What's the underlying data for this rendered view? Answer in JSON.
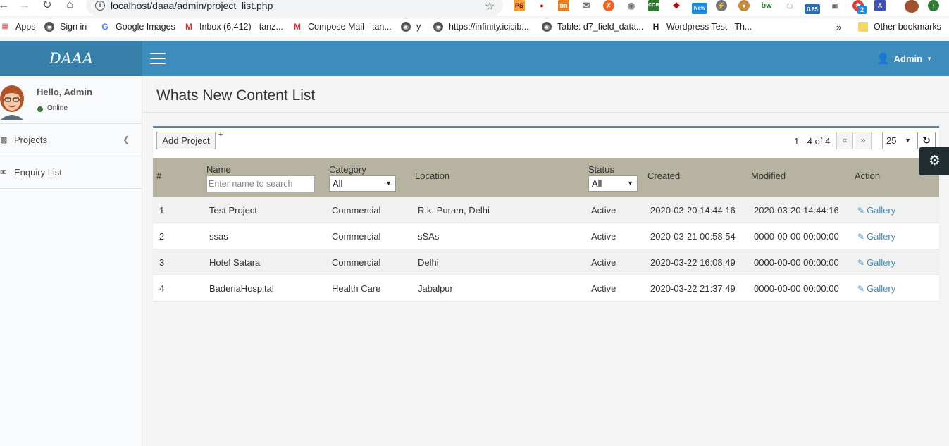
{
  "browser": {
    "url_host": "localhost",
    "url_path": "/daaa/admin/project_list.php",
    "bookmarks": [
      {
        "label": "Apps",
        "icon": "apps-grid-icon"
      },
      {
        "label": "Sign in",
        "icon": "globe-icon"
      },
      {
        "label": "Google Images",
        "icon": "google-icon"
      },
      {
        "label": "Inbox (6,412) - tanz...",
        "icon": "gmail-icon"
      },
      {
        "label": "Compose Mail - tan...",
        "icon": "gmail-icon"
      },
      {
        "label": "y",
        "icon": "globe-icon"
      },
      {
        "label": "https://infinity.icicib...",
        "icon": "globe-icon"
      },
      {
        "label": "Table: d7_field_data...",
        "icon": "globe-icon"
      },
      {
        "label": "Wordpress Test | Th...",
        "icon": "h-icon"
      }
    ],
    "more_bookmarks": "»",
    "other_bookmarks": "Other bookmarks",
    "extension_badges": {
      "new": "New",
      "speed": "0.85",
      "count": "2"
    }
  },
  "header": {
    "logo": "DAAA",
    "user_label": "Admin"
  },
  "sidebar": {
    "greeting": "Hello, Admin",
    "status": "Online",
    "items": [
      {
        "label": "Projects",
        "icon": "bar-chart-icon"
      },
      {
        "label": "Enquiry List",
        "icon": "envelope-icon"
      }
    ]
  },
  "page": {
    "title": "Whats New Content List"
  },
  "toolbar": {
    "add_label": "Add Project",
    "plus": "+",
    "pager_info": "1 - 4 of 4",
    "prev": "«",
    "next": "»",
    "page_size": "25"
  },
  "table": {
    "columns": {
      "num": "#",
      "name": "Name",
      "category": "Category",
      "location": "Location",
      "status": "Status",
      "created": "Created",
      "modified": "Modified",
      "action": "Action"
    },
    "search_placeholder": "Enter name to search",
    "category_filter": "All",
    "status_filter": "All",
    "rows": [
      {
        "num": "1",
        "name": "Test Project",
        "category": "Commercial",
        "location": "R.k. Puram, Delhi",
        "status": "Active",
        "created": "2020-03-20 14:44:16",
        "modified": "2020-03-20 14:44:16",
        "action": "Gallery"
      },
      {
        "num": "2",
        "name": "ssas",
        "category": "Commercial",
        "location": "sSAs",
        "status": "Active",
        "created": "2020-03-21 00:58:54",
        "modified": "0000-00-00 00:00:00",
        "action": "Gallery"
      },
      {
        "num": "3",
        "name": "Hotel Satara",
        "category": "Commercial",
        "location": "Delhi",
        "status": "Active",
        "created": "2020-03-22 16:08:49",
        "modified": "0000-00-00 00:00:00",
        "action": "Gallery"
      },
      {
        "num": "4",
        "name": "BaderiaHospital",
        "category": "Health Care",
        "location": "Jabalpur",
        "status": "Active",
        "created": "2020-03-22 21:37:49",
        "modified": "0000-00-00 00:00:00",
        "action": "Gallery"
      }
    ]
  },
  "colors": {
    "header": "#3c8dbc",
    "logo_bg": "#367fa9",
    "table_header": "#b6b3a1",
    "settings_tab": "#222d32"
  }
}
